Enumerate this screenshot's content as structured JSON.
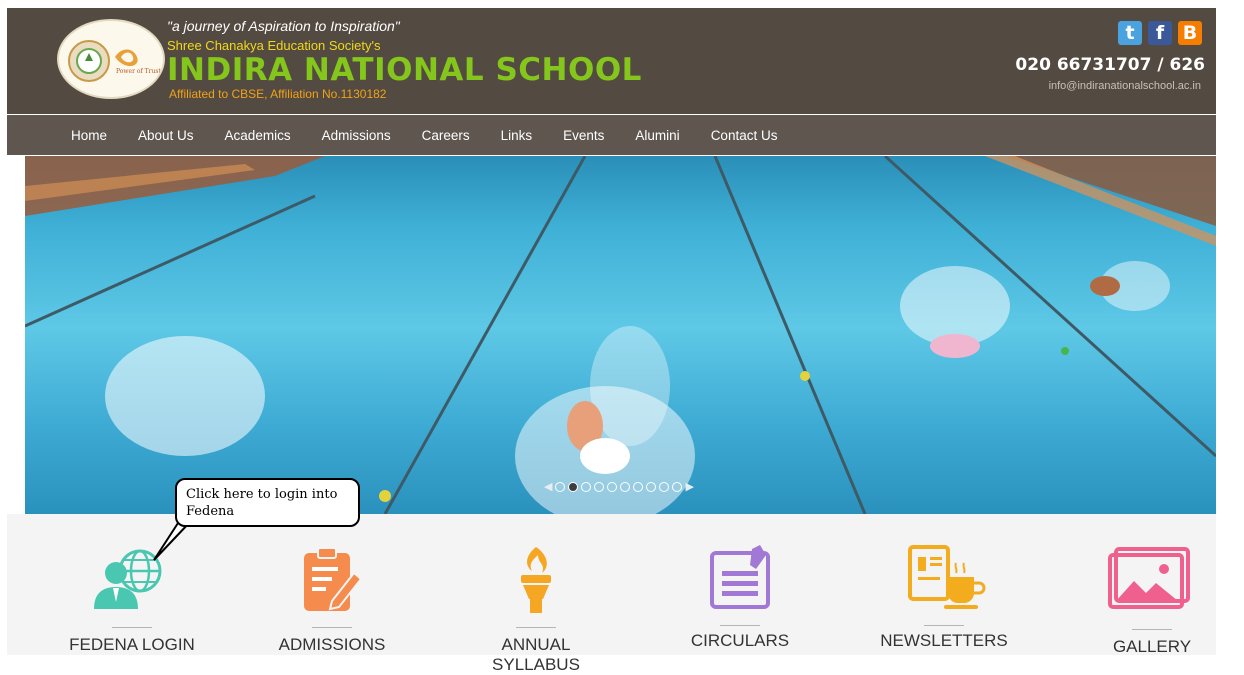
{
  "header": {
    "tagline": "\"a journey of Aspiration to Inspiration\"",
    "society": "Shree Chanakya Education Society's",
    "school_name": "INDIRA NATIONAL SCHOOL",
    "affiliation": "Affiliated to CBSE, Affiliation No.1130182",
    "phone": "020 66731707 / 626",
    "email": "info@indiranationalschool.ac.in",
    "social": [
      "twitter-icon",
      "facebook-icon",
      "blogger-icon"
    ]
  },
  "nav": {
    "items": [
      "Home",
      "About Us",
      "Academics",
      "Admissions",
      "Careers",
      "Links",
      "Events",
      "Alumini",
      "Contact Us"
    ]
  },
  "slider": {
    "dot_count": 10,
    "active_index": 1
  },
  "callout": {
    "text": "Click here to login into Fedena"
  },
  "tiles": [
    {
      "label": "FEDENA LOGIN",
      "icon": "fedena-login-icon",
      "color": "#49c7b1"
    },
    {
      "label": "ADMISSIONS",
      "icon": "admissions-icon",
      "color": "#f58b4c"
    },
    {
      "label": "ANNUAL SYLLABUS",
      "icon": "torch-icon",
      "color": "#f5a623"
    },
    {
      "label": "CIRCULARS",
      "icon": "circular-icon",
      "color": "#a278d6"
    },
    {
      "label": "NEWSLETTERS",
      "icon": "newsletter-icon",
      "color": "#f2ac1e"
    },
    {
      "label": "GALLERY",
      "icon": "gallery-icon",
      "color": "#f0608f"
    }
  ]
}
